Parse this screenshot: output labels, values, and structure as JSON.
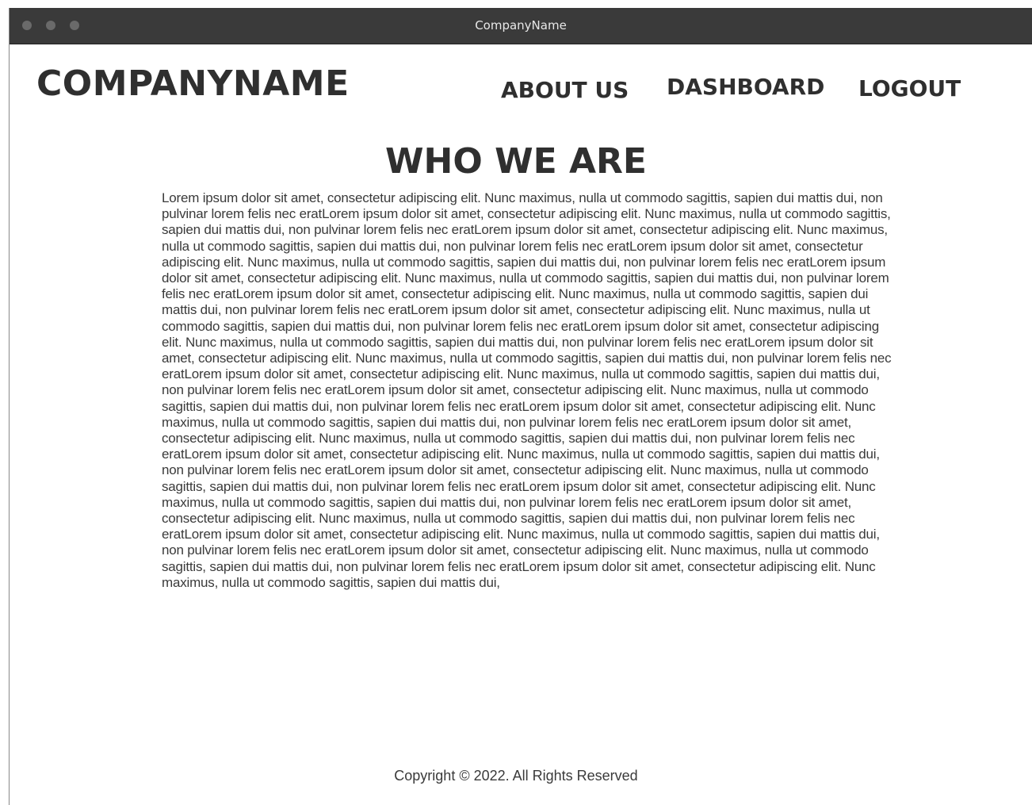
{
  "window": {
    "title": "CompanyName"
  },
  "header": {
    "logo": "COMPANYNAME",
    "nav": {
      "about": "ABOUT US",
      "dashboard": "DASHBOARD",
      "logout": "LOGOUT"
    }
  },
  "main": {
    "heading": "WHO WE ARE",
    "body": "Lorem ipsum dolor sit amet, consectetur adipiscing elit. Nunc maximus, nulla ut commodo sagittis, sapien dui mattis dui, non pulvinar lorem felis nec eratLorem ipsum dolor sit amet, consectetur adipiscing elit. Nunc maximus, nulla ut commodo sagittis, sapien dui mattis dui, non pulvinar lorem felis nec eratLorem ipsum dolor sit amet, consectetur adipiscing elit. Nunc maximus, nulla ut commodo sagittis, sapien dui mattis dui, non pulvinar lorem felis nec eratLorem ipsum dolor sit amet, consectetur adipiscing elit. Nunc maximus, nulla ut commodo sagittis, sapien dui mattis dui, non pulvinar lorem felis nec eratLorem ipsum dolor sit amet, consectetur adipiscing elit. Nunc maximus, nulla ut commodo sagittis, sapien dui mattis dui, non pulvinar lorem felis nec eratLorem ipsum dolor sit amet, consectetur adipiscing elit. Nunc maximus, nulla ut commodo sagittis, sapien dui mattis dui, non pulvinar lorem felis nec eratLorem ipsum dolor sit amet, consectetur adipiscing elit. Nunc maximus, nulla ut commodo sagittis, sapien dui mattis dui, non pulvinar lorem felis nec eratLorem ipsum dolor sit amet, consectetur adipiscing elit. Nunc maximus, nulla ut commodo sagittis, sapien dui mattis dui, non pulvinar lorem felis nec eratLorem ipsum dolor sit amet, consectetur adipiscing elit. Nunc maximus, nulla ut commodo sagittis, sapien dui mattis dui, non pulvinar lorem felis nec eratLorem ipsum dolor sit amet, consectetur adipiscing elit. Nunc maximus, nulla ut commodo sagittis, sapien dui mattis dui, non pulvinar lorem felis nec eratLorem ipsum dolor sit amet, consectetur adipiscing elit. Nunc maximus, nulla ut commodo sagittis, sapien dui mattis dui, non pulvinar lorem felis nec eratLorem ipsum dolor sit amet, consectetur adipiscing elit. Nunc maximus, nulla ut commodo sagittis, sapien dui mattis dui, non pulvinar lorem felis nec eratLorem ipsum dolor sit amet, consectetur adipiscing elit. Nunc maximus, nulla ut commodo sagittis, sapien dui mattis dui, non pulvinar lorem felis nec eratLorem ipsum dolor sit amet, consectetur adipiscing elit. Nunc maximus, nulla ut commodo sagittis, sapien dui mattis dui, non pulvinar lorem felis nec eratLorem ipsum dolor sit amet, consectetur adipiscing elit. Nunc maximus, nulla ut commodo sagittis, sapien dui mattis dui, non pulvinar lorem felis nec eratLorem ipsum dolor sit amet, consectetur adipiscing elit. Nunc maximus, nulla ut commodo sagittis, sapien dui mattis dui, non pulvinar lorem felis nec eratLorem ipsum dolor sit amet, consectetur adipiscing elit. Nunc maximus, nulla ut commodo sagittis, sapien dui mattis dui, non pulvinar lorem felis nec eratLorem ipsum dolor sit amet, consectetur adipiscing elit. Nunc maximus, nulla ut commodo sagittis, sapien dui mattis dui, non pulvinar lorem felis nec eratLorem ipsum dolor sit amet, consectetur adipiscing elit. Nunc maximus, nulla ut commodo sagittis, sapien dui mattis dui, non pulvinar lorem felis nec eratLorem ipsum dolor sit amet, consectetur adipiscing elit. Nunc maximus, nulla ut commodo sagittis, sapien dui mattis dui,"
  },
  "footer": {
    "copyright": "Copyright  © 2022. All Rights Reserved"
  }
}
